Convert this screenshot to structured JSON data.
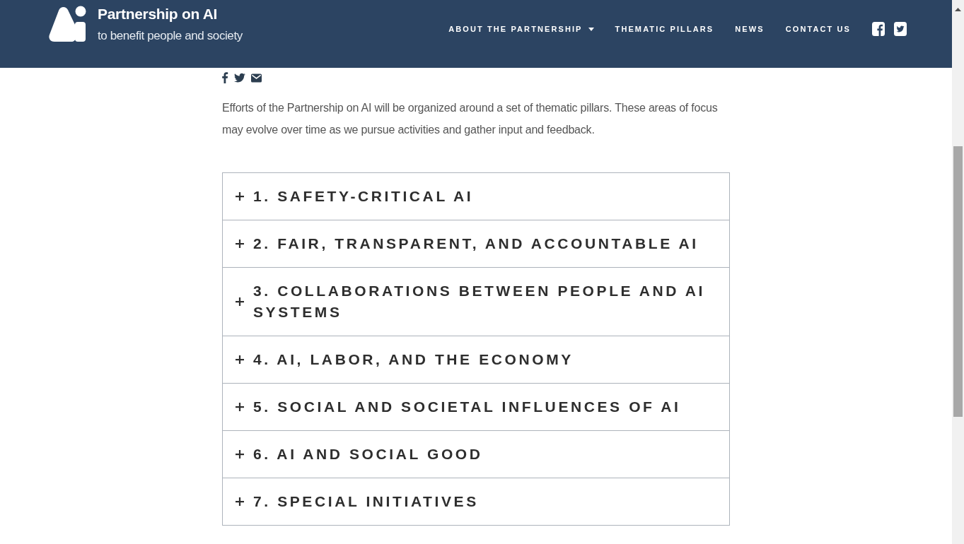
{
  "header": {
    "logo": {
      "title": "Partnership on AI",
      "tagline": "to benefit people and society"
    },
    "nav": [
      {
        "label": "ABOUT THE PARTNERSHIP",
        "dropdown": true
      },
      {
        "label": "THEMATIC PILLARS",
        "dropdown": false
      },
      {
        "label": "NEWS",
        "dropdown": false
      },
      {
        "label": "CONTACT US",
        "dropdown": false
      }
    ]
  },
  "intro": "Efforts of the Partnership on AI will be organized around a set of thematic pillars. These areas of focus may evolve over time as we pursue activities and gather input and feedback.",
  "pillars": [
    {
      "title": "1. SAFETY-CRITICAL AI",
      "expanded": false
    },
    {
      "title": "2. FAIR, TRANSPARENT, AND ACCOUNTABLE AI",
      "expanded": false
    },
    {
      "title": "3. COLLABORATIONS BETWEEN PEOPLE AND AI SYSTEMS",
      "expanded": false
    },
    {
      "title": "4. AI, LABOR, AND THE ECONOMY",
      "expanded": false
    },
    {
      "title": "5. SOCIAL AND SOCIETAL INFLUENCES OF AI",
      "expanded": false
    },
    {
      "title": "6. AI AND SOCIAL GOOD",
      "expanded": false
    },
    {
      "title": "7. SPECIAL INITIATIVES",
      "expanded": false
    }
  ]
}
